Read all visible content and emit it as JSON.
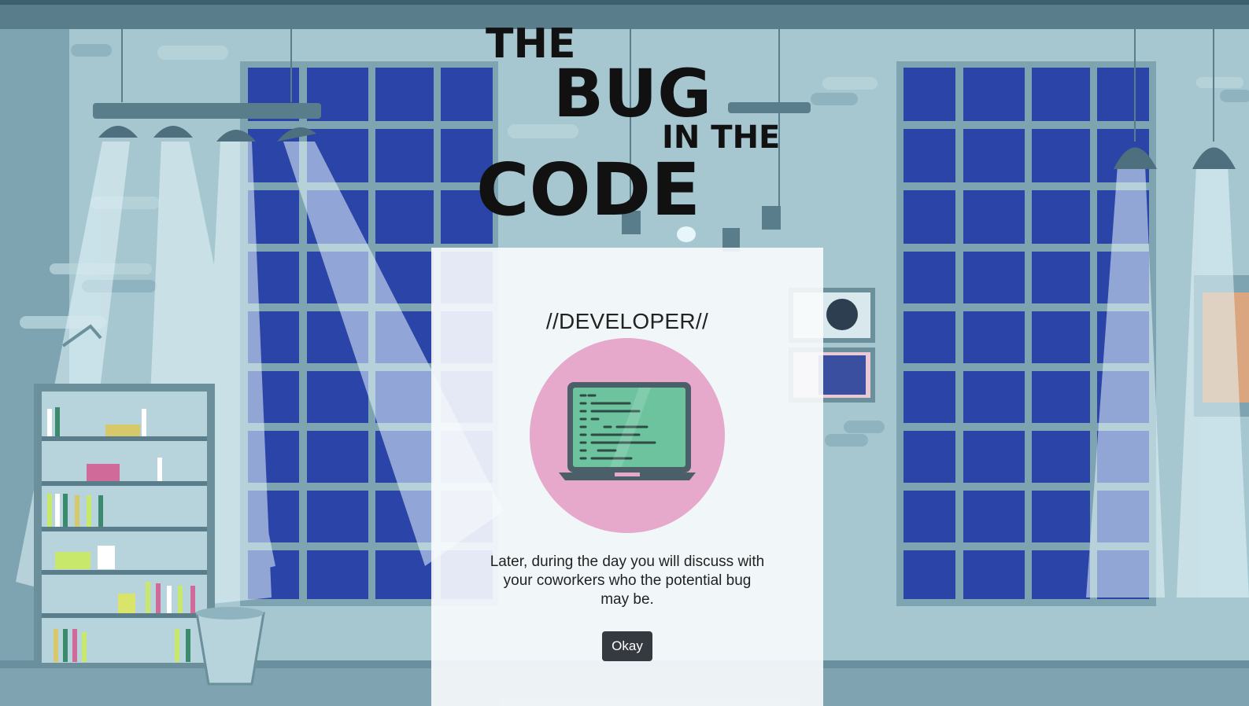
{
  "logo": {
    "line1": "THE",
    "line2": "BUG",
    "line3": "IN THE",
    "line4": "CODE"
  },
  "dialog": {
    "title": "//DEVELOPER//",
    "message": "Later, during the day you will discuss with your coworkers who the potential bug may be.",
    "okay_label": "Okay"
  },
  "colors": {
    "window_glass": "#2a44a8",
    "wall": "#9cbfc9",
    "avatar_circle": "#e6a8cb",
    "screen": "#6cc39e",
    "button": "#343a40"
  }
}
